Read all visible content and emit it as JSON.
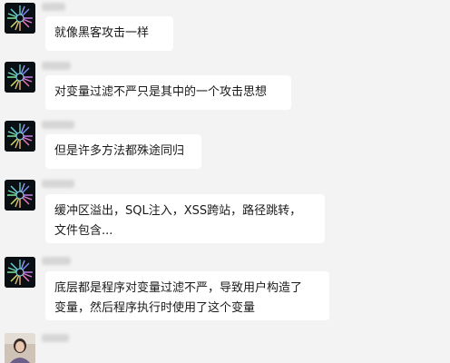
{
  "messages": [
    {
      "sender": "",
      "lines": [
        "就像黑客攻击一样"
      ]
    },
    {
      "sender": "",
      "lines": [
        "对变量过滤不严只是其中的一个攻击思想"
      ]
    },
    {
      "sender": "",
      "lines": [
        "但是许多方法都殊途同归"
      ]
    },
    {
      "sender": "",
      "lines": [
        "缓冲区溢出，SQL注入，XSS跨站，路径跳转，",
        "文件包含..."
      ]
    },
    {
      "sender": "",
      "lines": [
        "底层都是程序对变量过滤不严，导致用户构造了",
        "变量，然后程序执行时使用了这个变量"
      ]
    }
  ],
  "colors": {
    "background": "#f3f3f3",
    "bubble": "#ffffff",
    "text": "#1a1a1a",
    "name_placeholder": "#d6d6d6"
  },
  "icons": {
    "user_avatar": "radial-burst-avatar-icon",
    "other_avatar": "person-photo-avatar-icon"
  }
}
